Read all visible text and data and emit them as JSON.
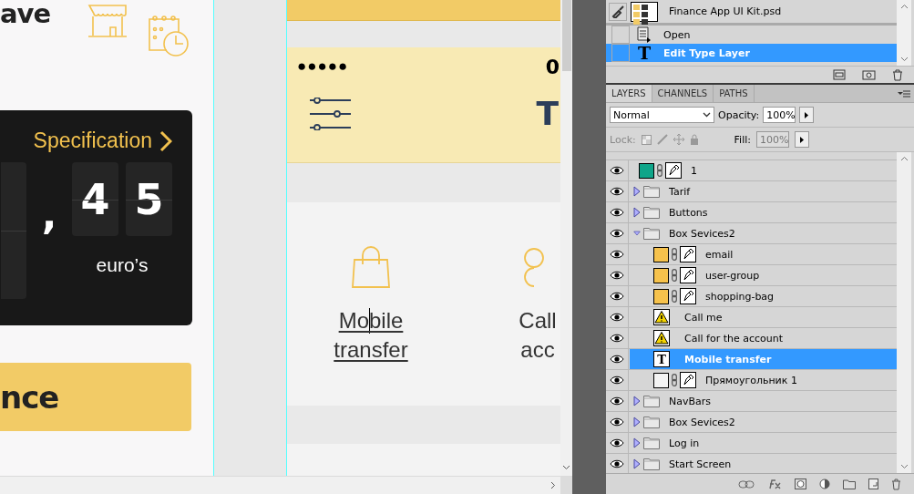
{
  "canvas": {
    "left_artboard": {
      "heading_fragment": "ave",
      "card": {
        "link": "Specification",
        "separator": ",",
        "digits": [
          "4",
          "5"
        ],
        "unit": "euro’s"
      },
      "button_fragment": "nce"
    },
    "right_artboard": {
      "pin": "●●●●●",
      "value_fragment": "0",
      "title_fragment": "T",
      "services": [
        {
          "lines": [
            "Mobile",
            "transfer"
          ],
          "editing": true
        },
        {
          "lines": [
            "Call",
            "acc"
          ],
          "editing": false
        }
      ]
    }
  },
  "history": {
    "document": "Finance App UI Kit.psd",
    "steps": [
      {
        "label": "Open",
        "kind": "open",
        "selected": false
      },
      {
        "label": "Edit Type Layer",
        "kind": "type",
        "icon_text": "T",
        "selected": true
      }
    ]
  },
  "layers_panel": {
    "tabs": [
      {
        "label": "LAYERS",
        "selected": true
      },
      {
        "label": "CHANNELS",
        "selected": false
      },
      {
        "label": "PATHS",
        "selected": false
      }
    ],
    "blend_mode": "Normal",
    "opacity_label": "Opacity:",
    "opacity": "100%",
    "lock_label": "Lock:",
    "fill_label": "Fill:",
    "fill": "100%",
    "layers": [
      {
        "name": "1",
        "kind": "shape",
        "color": "#0fa589",
        "visible": true,
        "selected": false
      },
      {
        "name": "Tarif",
        "kind": "group",
        "expanded": false,
        "visible": true,
        "selected": false
      },
      {
        "name": "Buttons",
        "kind": "group",
        "expanded": false,
        "visible": true,
        "selected": false
      },
      {
        "name": "Box Sevices2",
        "kind": "group",
        "expanded": true,
        "visible": true,
        "selected": false,
        "children": [
          {
            "name": "email",
            "kind": "shape",
            "color": "#f6c24c",
            "visible": true,
            "selected": false
          },
          {
            "name": "user-group",
            "kind": "shape",
            "color": "#f6c24c",
            "visible": true,
            "selected": false
          },
          {
            "name": "shopping-bag",
            "kind": "shape",
            "color": "#f6c24c",
            "visible": true,
            "selected": false
          },
          {
            "name": "Call me",
            "kind": "warning",
            "visible": true,
            "selected": false
          },
          {
            "name": "Call for the account",
            "kind": "warning",
            "visible": true,
            "selected": false
          },
          {
            "name": "Mobile transfer",
            "kind": "text",
            "icon_text": "T",
            "visible": true,
            "selected": true
          },
          {
            "name": "Прямоугольник 1",
            "kind": "shape",
            "color": "#f4f4f4",
            "visible": true,
            "selected": false
          }
        ]
      },
      {
        "name": "NavBars",
        "kind": "group",
        "expanded": false,
        "visible": true,
        "selected": false
      },
      {
        "name": "Box Sevices2",
        "kind": "group",
        "expanded": false,
        "visible": true,
        "selected": false
      },
      {
        "name": "Log in",
        "kind": "group",
        "expanded": false,
        "visible": true,
        "selected": false
      },
      {
        "name": "Start Screen",
        "kind": "group",
        "expanded": false,
        "visible": true,
        "selected": false
      }
    ]
  }
}
